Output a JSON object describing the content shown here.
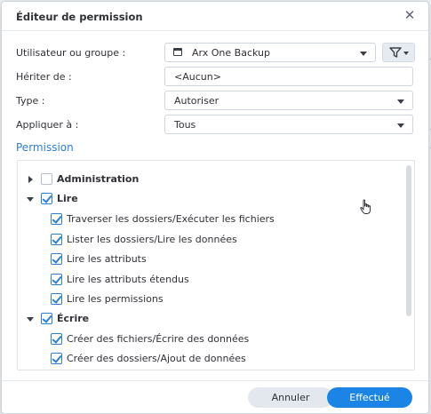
{
  "dialog": {
    "title": "Éditeur de permission",
    "close_icon": "close-icon"
  },
  "form": {
    "user_label": "Utilisateur ou groupe :",
    "user_value": "Arx One Backup",
    "user_icon": "window-icon",
    "filter_icon": "filter-icon",
    "inherit_label": "Hériter de :",
    "inherit_value": "<Aucun>",
    "type_label": "Type :",
    "type_value": "Autoriser",
    "apply_label": "Appliquer à :",
    "apply_value": "Tous"
  },
  "permission": {
    "title": "Permission",
    "nodes": [
      {
        "label": "Administration",
        "checked": false,
        "level": 0,
        "expanded": false
      },
      {
        "label": "Lire",
        "checked": true,
        "level": 0,
        "expanded": true
      },
      {
        "label": "Traverser les dossiers/Exécuter les fichiers",
        "checked": true,
        "level": 1
      },
      {
        "label": "Lister les dossiers/Lire les données",
        "checked": true,
        "level": 1
      },
      {
        "label": "Lire les attributs",
        "checked": true,
        "level": 1
      },
      {
        "label": "Lire les attributs étendus",
        "checked": true,
        "level": 1
      },
      {
        "label": "Lire les permissions",
        "checked": true,
        "level": 1
      },
      {
        "label": "Écrire",
        "checked": true,
        "level": 0,
        "expanded": true
      },
      {
        "label": "Créer des fichiers/Écrire des données",
        "checked": true,
        "level": 1
      },
      {
        "label": "Créer des dossiers/Ajout de données",
        "checked": true,
        "level": 1
      }
    ]
  },
  "footer": {
    "cancel_label": "Annuler",
    "ok_label": "Effectué"
  },
  "colors": {
    "accent": "#1b84e4",
    "link": "#2d7fd1"
  }
}
